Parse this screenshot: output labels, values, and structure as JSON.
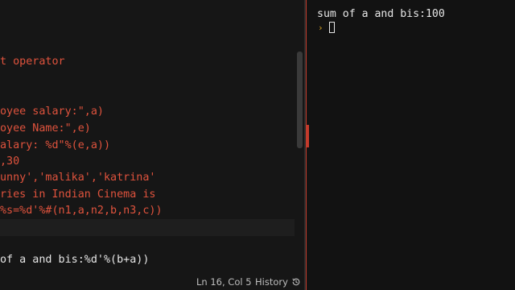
{
  "editor": {
    "lines": [
      {
        "text": "t operator",
        "color": "#e0533d"
      },
      {
        "text": "oyee salary:\",a)",
        "color": "#e0533d"
      },
      {
        "text": "oyee Name:\",e)",
        "color": "#e0533d"
      },
      {
        "text": "alary: %d\"%(e,a))",
        "color": "#e0533d"
      },
      {
        "text": ",30",
        "color": "#e0533d"
      },
      {
        "text": "unny','malika','katrina'",
        "color": "#e0533d"
      },
      {
        "text": "ries in Indian Cinema is",
        "color": "#e0533d"
      },
      {
        "text": "%s=%d'%#(n1,a,n2,b,n3,c))",
        "color": "#e0533d"
      },
      {
        "text": "of a and bis:%d'%(b+a))",
        "color": "#e6e6e6"
      }
    ]
  },
  "statusbar": {
    "cursor_position": "Ln 16, Col 5",
    "history_label": "History",
    "history_icon": "history-clock-icon"
  },
  "console": {
    "output": "sum of a and bis:100",
    "prompt_symbol": "›",
    "prompt_color": "#d9a322"
  },
  "colors": {
    "code_red": "#e0533d",
    "divider_accent": "#c43a2b",
    "background": "#121212"
  }
}
